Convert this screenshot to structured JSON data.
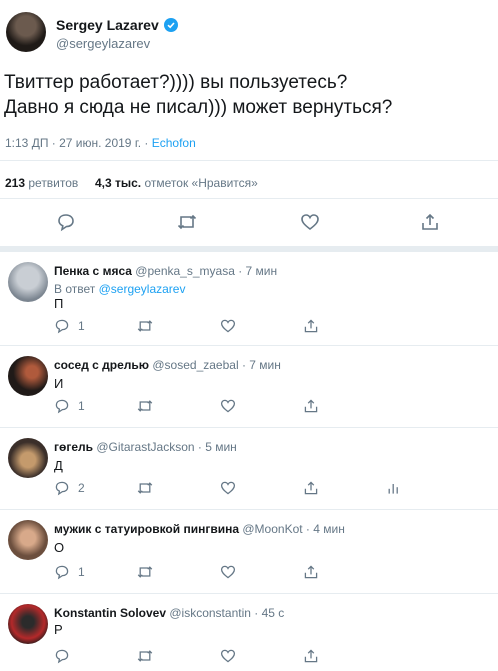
{
  "author": {
    "name": "Sergey Lazarev",
    "handle": "@sergeylazarev"
  },
  "tweet": {
    "text": "Твиттер работает?)))) вы пользуетесь?\nДавно я сюда не писал)))  может вернуться?",
    "time": "1:13 ДП · 27 июн. 2019 г. · ",
    "source": "Echofon",
    "retweets_count": "213",
    "retweets_label": " ретвитов",
    "likes_count": "4,3 тыс.",
    "likes_label": " отметок «Нравится»"
  },
  "replies": [
    {
      "name": "Пенка с мяса",
      "handle": "@penka_s_myasa · 7 мин",
      "reply_prefix": "В ответ ",
      "reply_to": "@sergeylazarev",
      "text": "П",
      "reply_count": "1"
    },
    {
      "name": "сосед с дрелью",
      "handle": "@sosed_zaebal · 7 мин",
      "text": "И",
      "reply_count": "1"
    },
    {
      "name": "гөгель",
      "handle": "@GitarastJackson · 5 мин",
      "text": "Д",
      "reply_count": "2"
    },
    {
      "name": "мужик с татуировкой пингвина",
      "handle": "@MoonKot · 4 мин",
      "text": "О",
      "reply_count": "1"
    },
    {
      "name": "Konstantin Solovev",
      "handle": "@iskconstantin · 45 с",
      "text": "Р",
      "reply_count": ""
    }
  ],
  "icons": {
    "reply": "reply-icon",
    "retweet": "retweet-icon",
    "like": "heart-icon",
    "share": "share-icon",
    "analytics": "analytics-icon",
    "verified": "verified-badge-icon"
  },
  "colors": {
    "accent": "#1da1f2",
    "muted": "#657786",
    "divider": "#e6ecf0"
  }
}
